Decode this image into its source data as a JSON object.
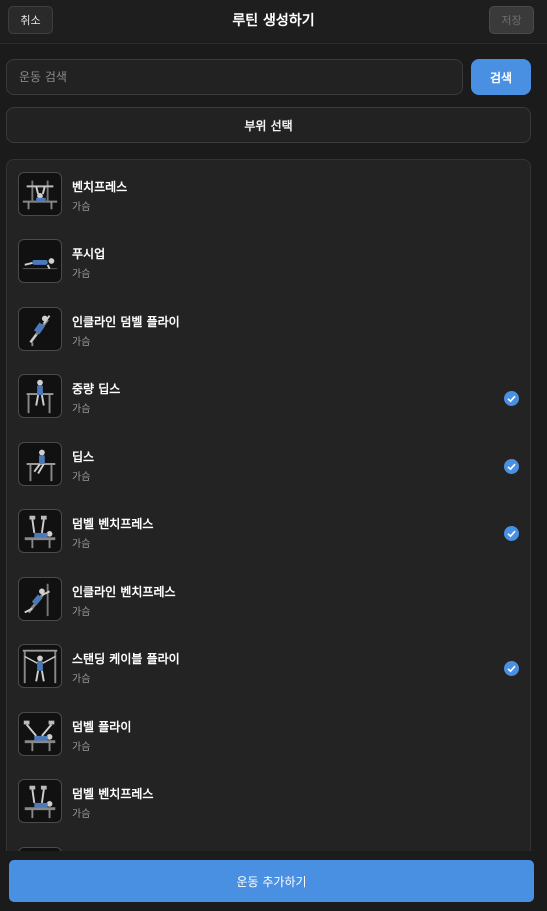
{
  "header": {
    "cancel_label": "취소",
    "title": "루틴 생성하기",
    "save_label": "저장"
  },
  "search": {
    "placeholder": "운동 검색",
    "value": "",
    "button_label": "검색"
  },
  "body_part_button": "부위 선택",
  "exercises": [
    {
      "name": "벤치프레스",
      "category": "가슴",
      "selected": false,
      "icon": "bench-press-icon"
    },
    {
      "name": "푸시업",
      "category": "가슴",
      "selected": false,
      "icon": "push-up-icon"
    },
    {
      "name": "인클라인 덤벨 플라이",
      "category": "가슴",
      "selected": false,
      "icon": "incline-fly-icon"
    },
    {
      "name": "중량 딥스",
      "category": "가슴",
      "selected": true,
      "icon": "weighted-dips-icon"
    },
    {
      "name": "딥스",
      "category": "가슴",
      "selected": true,
      "icon": "dips-icon"
    },
    {
      "name": "덤벨 벤치프레스",
      "category": "가슴",
      "selected": true,
      "icon": "dumbbell-bench-press-icon"
    },
    {
      "name": "인클라인 벤치프레스",
      "category": "가슴",
      "selected": false,
      "icon": "incline-bench-press-icon"
    },
    {
      "name": "스탠딩 케이블 플라이",
      "category": "가슴",
      "selected": true,
      "icon": "cable-fly-icon"
    },
    {
      "name": "덤벨 플라이",
      "category": "가슴",
      "selected": false,
      "icon": "dumbbell-fly-icon"
    },
    {
      "name": "덤벨 벤치프레스",
      "category": "가슴",
      "selected": false,
      "icon": "dumbbell-bench-press-icon"
    }
  ],
  "add_button_label": "운동 추가하기",
  "colors": {
    "accent": "#4a90e2",
    "background": "#1b1b1b",
    "panel": "#232323"
  }
}
